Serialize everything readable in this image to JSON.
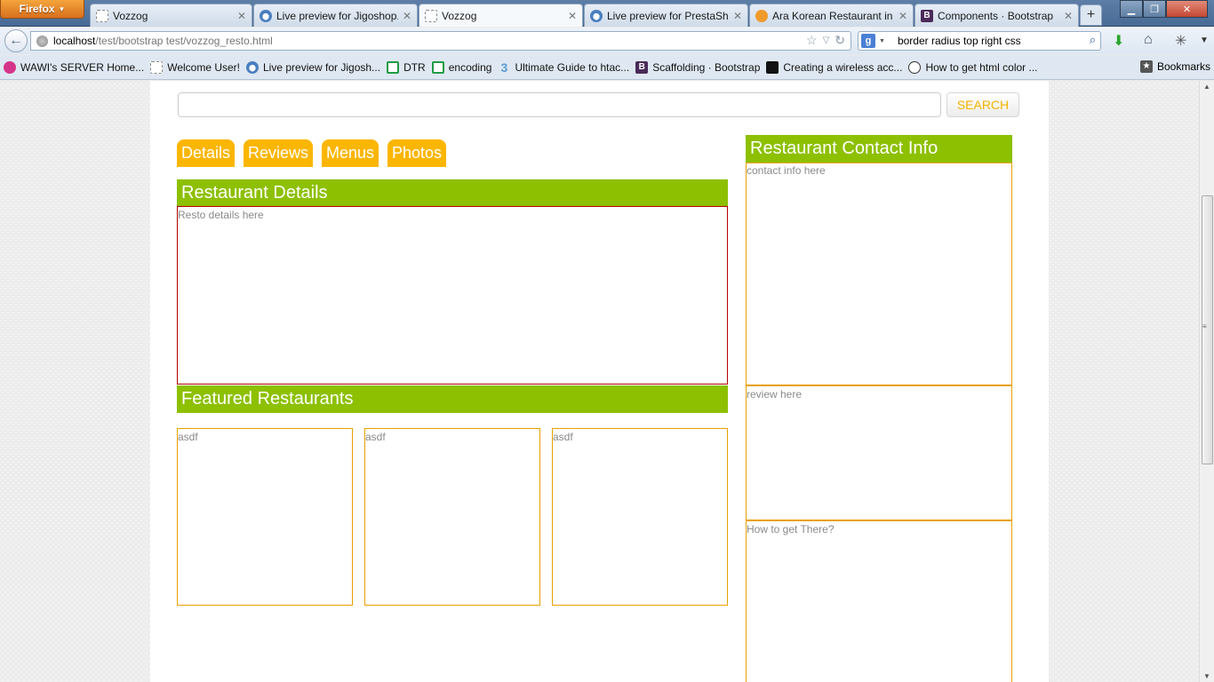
{
  "browser": {
    "app_button": "Firefox",
    "tabs": [
      {
        "title": "Vozzog",
        "icon": "page-icon",
        "active": false
      },
      {
        "title": "Live preview for Jigoshop...",
        "icon": "jigoshop-icon",
        "active": false
      },
      {
        "title": "Vozzog",
        "icon": "page-icon",
        "active": true
      },
      {
        "title": "Live preview for PrestaSh...",
        "icon": "jigoshop-icon",
        "active": false
      },
      {
        "title": "Ara Korean Restaurant in ...",
        "icon": "ara-icon",
        "active": false
      },
      {
        "title": "Components · Bootstrap",
        "icon": "bootstrap-icon",
        "active": false
      }
    ],
    "new_tab": "+",
    "url": {
      "host": "localhost",
      "path": "/test/bootstrap test/vozzog_resto.html"
    },
    "search": {
      "engine": "g",
      "value": "border radius top right css"
    },
    "bookmarks": [
      {
        "label": "WAWI's SERVER Home...",
        "icon": "wawi-icon"
      },
      {
        "label": "Welcome User!",
        "icon": "page-icon"
      },
      {
        "label": "Live preview for Jigosh...",
        "icon": "jigoshop-icon"
      },
      {
        "label": "DTR",
        "icon": "sheet-icon"
      },
      {
        "label": "encoding",
        "icon": "sheet-icon"
      },
      {
        "label": "Ultimate Guide to htac...",
        "icon": "three-icon"
      },
      {
        "label": "Scaffolding · Bootstrap",
        "icon": "bootstrap-icon"
      },
      {
        "label": "Creating a wireless acc...",
        "icon": "mask-icon"
      },
      {
        "label": "How to get html color ...",
        "icon": "smile-icon"
      }
    ],
    "bookmarks_menu": "Bookmarks"
  },
  "page": {
    "search_button": "SEARCH",
    "search_placeholder": "",
    "tabs": [
      "Details",
      "Reviews",
      "Menus",
      "Photos"
    ],
    "details": {
      "header": "Restaurant Details",
      "body": "Resto details here"
    },
    "featured": {
      "header": "Featured Restaurants",
      "items": [
        "asdf",
        "asdf",
        "asdf"
      ]
    },
    "contact": {
      "header": "Restaurant Contact Info",
      "body": "contact info here"
    },
    "review": {
      "body": "review here"
    },
    "directions": {
      "body": "How to get There?"
    }
  },
  "colors": {
    "tab_orange": "#fbb600",
    "header_green": "#8dc000",
    "border_orange": "#e8a000",
    "border_red": "#b40000"
  }
}
